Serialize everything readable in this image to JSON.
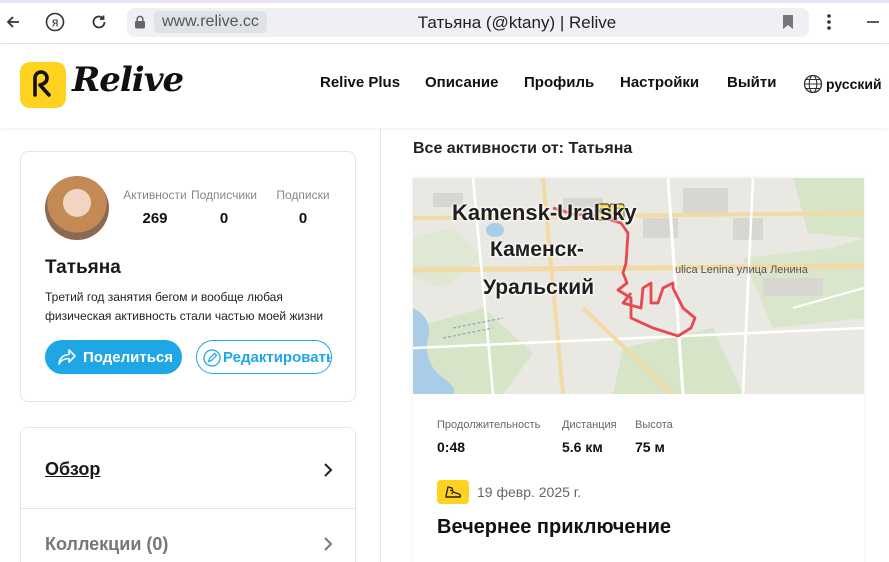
{
  "browser": {
    "url_domain": "www.relive.cc",
    "tab_title": "Татьяна (@ktany) | Relive"
  },
  "header": {
    "logo_text": "Relive",
    "nav": [
      "Relive Plus",
      "Описание",
      "Профиль",
      "Настройки",
      "Выйти"
    ],
    "language": "русский"
  },
  "profile": {
    "name": "Татьяна",
    "bio": "Третий год занятия бегом и вообще любая физическая активность стали частью моей жизни",
    "stats": [
      {
        "label": "Активности",
        "value": "269"
      },
      {
        "label": "Подписчики",
        "value": "0"
      },
      {
        "label": "Подписки",
        "value": "0"
      }
    ],
    "share_label": "Поделиться",
    "edit_label": "Редактировать"
  },
  "menu": {
    "overview": "Обзор",
    "collections": "Коллекции (0)"
  },
  "activities": {
    "section_title": "Все активности от: Татьяна",
    "map": {
      "city_en": "Kamensk-Uralsky",
      "city_ru_line1": "Каменск-",
      "city_ru_line2": "Уральский",
      "street": "ulica Lenina улица Ленина"
    },
    "metrics": [
      {
        "label": "Продолжительность",
        "value": "0:48"
      },
      {
        "label": "Дистанция",
        "value": "5.6 км"
      },
      {
        "label": "Высота",
        "value": "75 м"
      }
    ],
    "date": "19 февр. 2025 г.",
    "title": "Вечернее приключение"
  },
  "colors": {
    "brand_yellow": "#ffd21f",
    "accent_blue": "#1ea7e4",
    "route_red": "#e8484f"
  }
}
